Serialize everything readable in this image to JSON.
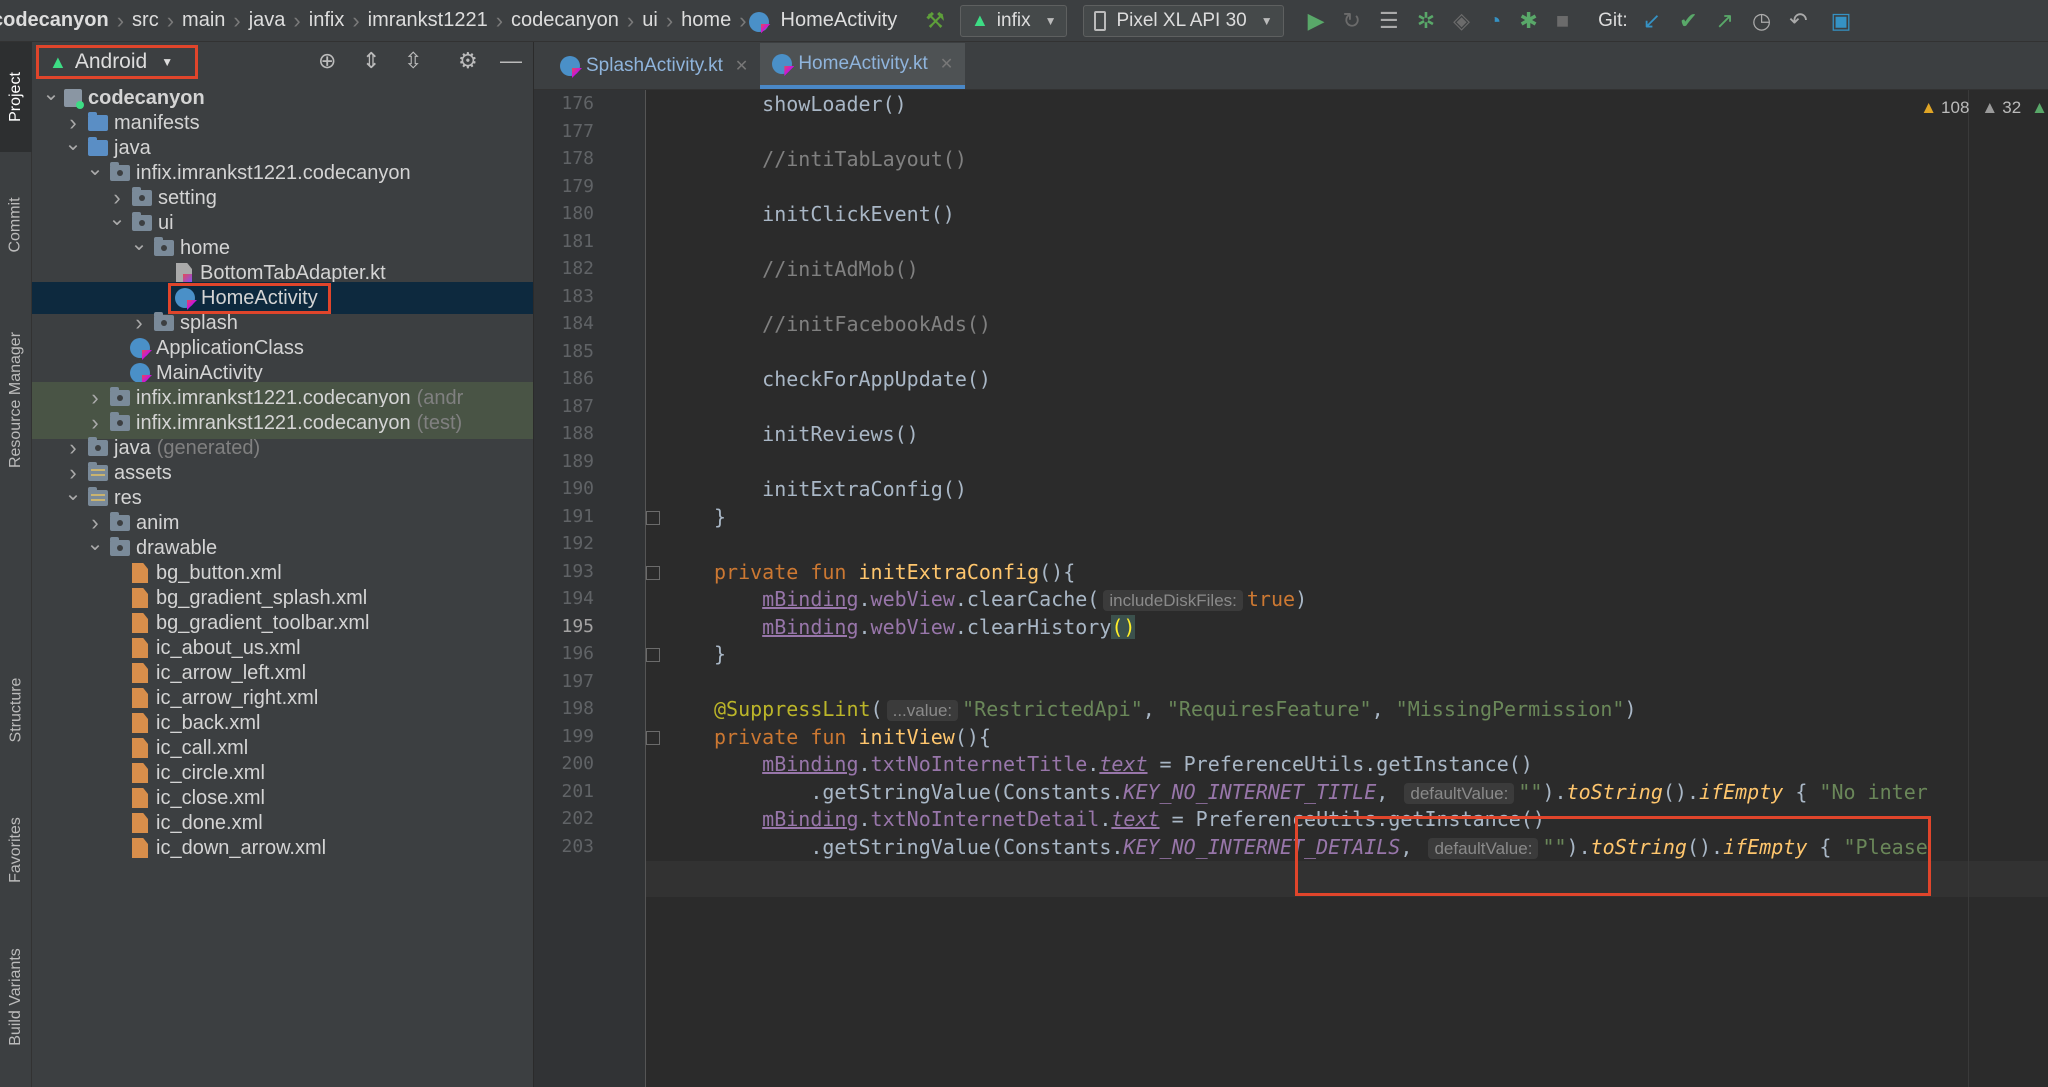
{
  "breadcrumb": [
    "codecanyon",
    "src",
    "main",
    "java",
    "infix",
    "imrankst1221",
    "codecanyon",
    "ui",
    "home",
    "HomeActivity"
  ],
  "toolbar": {
    "run_config": "infix",
    "device": "Pixel XL API 30",
    "git_label": "Git:",
    "icons": [
      "hammer-icon",
      "run-icon",
      "rerun-icon",
      "coverage-icon",
      "debug-icon",
      "attach-icon",
      "profile-icon",
      "apply-changes-icon",
      "stop-icon",
      "update-icon",
      "commit-icon",
      "push-icon",
      "history-icon",
      "rollback-icon",
      "avd-icon"
    ]
  },
  "left_strip": {
    "tabs": [
      "Project",
      "Commit",
      "Resource Manager",
      "Structure",
      "Favorites",
      "Build Variants"
    ]
  },
  "project_panel": {
    "view_mode": "Android",
    "tree": [
      {
        "label": "codecanyon",
        "indent": 0,
        "arrow": "down",
        "icon": "module",
        "bold": true
      },
      {
        "label": "manifests",
        "indent": 1,
        "arrow": "right",
        "icon": "folder-blue"
      },
      {
        "label": "java",
        "indent": 1,
        "arrow": "down",
        "icon": "folder-blue"
      },
      {
        "label": "infix.imrankst1221.codecanyon",
        "indent": 2,
        "arrow": "down",
        "icon": "package"
      },
      {
        "label": "setting",
        "indent": 3,
        "arrow": "right",
        "icon": "package"
      },
      {
        "label": "ui",
        "indent": 3,
        "arrow": "down",
        "icon": "package"
      },
      {
        "label": "home",
        "indent": 4,
        "arrow": "down",
        "icon": "package"
      },
      {
        "label": "BottomTabAdapter.kt",
        "indent": 5,
        "arrow": "none",
        "icon": "kotlin-file"
      },
      {
        "label": "HomeActivity",
        "indent": 5,
        "arrow": "none",
        "icon": "class",
        "selected": true,
        "highlighted": true
      },
      {
        "label": "splash",
        "indent": 4,
        "arrow": "right",
        "icon": "package"
      },
      {
        "label": "ApplicationClass",
        "indent": 3,
        "arrow": "none",
        "icon": "class"
      },
      {
        "label": "MainActivity",
        "indent": 3,
        "arrow": "none",
        "icon": "class"
      },
      {
        "label": "infix.imrankst1221.codecanyon",
        "suffix": "(andr",
        "indent": 2,
        "arrow": "right",
        "icon": "package",
        "tinted": true
      },
      {
        "label": "infix.imrankst1221.codecanyon",
        "suffix": "(test)",
        "indent": 2,
        "arrow": "right",
        "icon": "package",
        "tinted": true
      },
      {
        "label": "java",
        "suffix": "(generated)",
        "indent": 1,
        "arrow": "right",
        "icon": "folder-gen"
      },
      {
        "label": "assets",
        "indent": 1,
        "arrow": "right",
        "icon": "folder-res"
      },
      {
        "label": "res",
        "indent": 1,
        "arrow": "down",
        "icon": "folder-res"
      },
      {
        "label": "anim",
        "indent": 2,
        "arrow": "right",
        "icon": "package"
      },
      {
        "label": "drawable",
        "indent": 2,
        "arrow": "down",
        "icon": "package"
      },
      {
        "label": "bg_button.xml",
        "indent": 3,
        "arrow": "none",
        "icon": "xml"
      },
      {
        "label": "bg_gradient_splash.xml",
        "indent": 3,
        "arrow": "none",
        "icon": "xml"
      },
      {
        "label": "bg_gradient_toolbar.xml",
        "indent": 3,
        "arrow": "none",
        "icon": "xml"
      },
      {
        "label": "ic_about_us.xml",
        "indent": 3,
        "arrow": "none",
        "icon": "xml"
      },
      {
        "label": "ic_arrow_left.xml",
        "indent": 3,
        "arrow": "none",
        "icon": "xml"
      },
      {
        "label": "ic_arrow_right.xml",
        "indent": 3,
        "arrow": "none",
        "icon": "xml"
      },
      {
        "label": "ic_back.xml",
        "indent": 3,
        "arrow": "none",
        "icon": "xml"
      },
      {
        "label": "ic_call.xml",
        "indent": 3,
        "arrow": "none",
        "icon": "xml"
      },
      {
        "label": "ic_circle.xml",
        "indent": 3,
        "arrow": "none",
        "icon": "xml"
      },
      {
        "label": "ic_close.xml",
        "indent": 3,
        "arrow": "none",
        "icon": "xml"
      },
      {
        "label": "ic_done.xml",
        "indent": 3,
        "arrow": "none",
        "icon": "xml"
      },
      {
        "label": "ic_down_arrow.xml",
        "indent": 3,
        "arrow": "none",
        "icon": "xml"
      }
    ]
  },
  "editor": {
    "tabs": [
      {
        "label": "SplashActivity.kt",
        "active": false
      },
      {
        "label": "HomeActivity.kt",
        "active": true
      }
    ],
    "inspections": {
      "warnings": "108",
      "weak_warnings": "32"
    },
    "current_line": 195,
    "lines": [
      {
        "n": 176,
        "tokens": [
          [
            "    showLoader()",
            ""
          ]
        ]
      },
      {
        "n": 177,
        "tokens": []
      },
      {
        "n": 178,
        "tokens": [
          [
            "    //intiTabLayout()",
            "cmt"
          ]
        ]
      },
      {
        "n": 179,
        "tokens": []
      },
      {
        "n": 180,
        "tokens": [
          [
            "    initClickEvent()",
            ""
          ]
        ]
      },
      {
        "n": 181,
        "tokens": []
      },
      {
        "n": 182,
        "tokens": [
          [
            "    //initAdMob()",
            "cmt"
          ]
        ]
      },
      {
        "n": 183,
        "tokens": []
      },
      {
        "n": 184,
        "tokens": [
          [
            "    //initFacebookAds()",
            "cmt"
          ]
        ]
      },
      {
        "n": 185,
        "tokens": []
      },
      {
        "n": 186,
        "tokens": [
          [
            "    checkForAppUpdate()",
            ""
          ]
        ]
      },
      {
        "n": 187,
        "tokens": []
      },
      {
        "n": 188,
        "tokens": [
          [
            "    initReviews()",
            ""
          ]
        ]
      },
      {
        "n": 189,
        "tokens": []
      },
      {
        "n": 190,
        "tokens": [
          [
            "    initExtraConfig()",
            ""
          ]
        ]
      },
      {
        "n": 191,
        "tokens": [
          [
            "}",
            ""
          ]
        ]
      },
      {
        "n": 192,
        "tokens": []
      },
      {
        "n": 193,
        "tokens": [
          [
            "private fun ",
            "kw"
          ],
          [
            "initExtraConfig",
            "fn"
          ],
          [
            "(){",
            ""
          ]
        ]
      },
      {
        "n": 194,
        "tokens": [
          [
            "    ",
            ""
          ],
          [
            "mBinding",
            "prop"
          ],
          [
            ".",
            ""
          ],
          [
            "webView",
            "propp"
          ],
          [
            ".clearCache(",
            ""
          ],
          [
            "includeDiskFiles:",
            "hint"
          ],
          [
            "true",
            "kw"
          ],
          [
            ")",
            ""
          ]
        ]
      },
      {
        "n": 195,
        "tokens": [
          [
            "    ",
            ""
          ],
          [
            "mBinding",
            "prop"
          ],
          [
            ".",
            ""
          ],
          [
            "webView",
            "propp"
          ],
          [
            ".clearHistory",
            ""
          ],
          [
            "()",
            "paren-hl"
          ]
        ]
      },
      {
        "n": 196,
        "tokens": [
          [
            "}",
            ""
          ]
        ]
      },
      {
        "n": 197,
        "tokens": []
      },
      {
        "n": 198,
        "tokens": [
          [
            "@SuppressLint",
            "ann"
          ],
          [
            "(",
            ""
          ],
          [
            "...value:",
            "hint"
          ],
          [
            "\"RestrictedApi\"",
            "str"
          ],
          [
            ", ",
            ""
          ],
          [
            "\"RequiresFeature\"",
            "str"
          ],
          [
            ", ",
            ""
          ],
          [
            "\"MissingPermission\"",
            "str"
          ],
          [
            ")",
            ""
          ]
        ]
      },
      {
        "n": 199,
        "tokens": [
          [
            "private fun ",
            "kw"
          ],
          [
            "initView",
            "fn"
          ],
          [
            "(){",
            ""
          ]
        ]
      },
      {
        "n": 200,
        "tokens": [
          [
            "    ",
            ""
          ],
          [
            "mBinding",
            "prop"
          ],
          [
            ".",
            ""
          ],
          [
            "txtNoInternetTitle",
            "propp"
          ],
          [
            ".",
            ""
          ],
          [
            "text",
            "prop-i"
          ],
          [
            " = PreferenceUtils.getInstance()",
            ""
          ]
        ]
      },
      {
        "n": 201,
        "tokens": [
          [
            "        .getStringValue(Constants.",
            ""
          ],
          [
            "KEY_NO_INTERNET_TITLE",
            "const"
          ],
          [
            ", ",
            ""
          ],
          [
            "defaultValue:",
            "hint"
          ],
          [
            "\"\"",
            "str"
          ],
          [
            ").",
            ""
          ],
          [
            "toString",
            "fnit"
          ],
          [
            "().",
            ""
          ],
          [
            "ifEmpty",
            "fnit"
          ],
          [
            " { ",
            ""
          ],
          [
            "\"No inter",
            "str"
          ]
        ]
      },
      {
        "n": 202,
        "tokens": [
          [
            "    ",
            ""
          ],
          [
            "mBinding",
            "prop"
          ],
          [
            ".",
            ""
          ],
          [
            "txtNoInternetDetail",
            "propp"
          ],
          [
            ".",
            ""
          ],
          [
            "text",
            "prop-i"
          ],
          [
            " = PreferenceUtils.getInstance()",
            ""
          ]
        ]
      },
      {
        "n": 203,
        "tokens": [
          [
            "        .getStringValue(Constants.",
            ""
          ],
          [
            "KEY_NO_INTERNET_DETAILS",
            "const"
          ],
          [
            ", ",
            ""
          ],
          [
            "defaultValue:",
            "hint"
          ],
          [
            "\"\"",
            "str"
          ],
          [
            ").",
            ""
          ],
          [
            "toString",
            "fnit"
          ],
          [
            "().",
            ""
          ],
          [
            "ifEmpty",
            "fnit"
          ],
          [
            " { ",
            ""
          ],
          [
            "\"Please",
            "str"
          ]
        ]
      }
    ]
  }
}
